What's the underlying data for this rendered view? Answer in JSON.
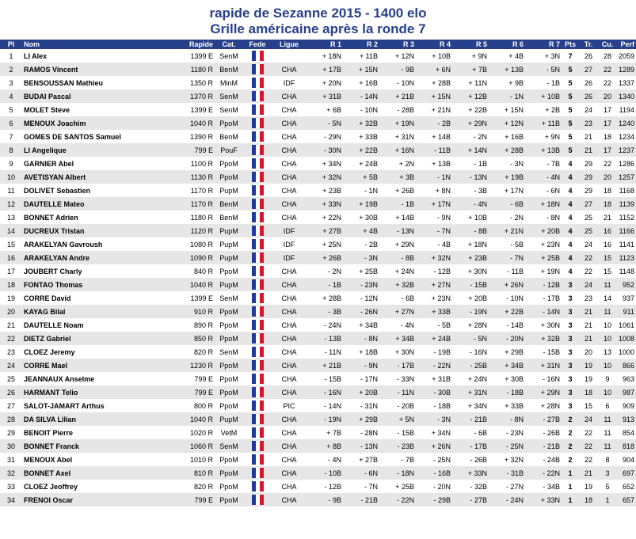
{
  "title": "rapide de Sezanne 2015 - 1400 elo",
  "subtitle": "Grille américaine après la ronde 7",
  "headers": [
    "Pl",
    "Nom",
    "Rapide",
    "Cat.",
    "Fede",
    "Ligue",
    "R 1",
    "R 2",
    "R 3",
    "R 4",
    "R 5",
    "R 6",
    "R 7",
    "Pts",
    "Tr.",
    "Cu.",
    "Perf"
  ],
  "flag": "FR flag",
  "rows": [
    [
      "1",
      "LI Alex",
      "1399 E",
      "SenM",
      "",
      "+ 18N",
      "+ 11B",
      "+ 12N",
      "+ 10B",
      "+ 9N",
      "+ 4B",
      "+ 3N",
      "7",
      "26",
      "28",
      "2059"
    ],
    [
      "2",
      "RAMOS Vincent",
      "1180 R",
      "BenM",
      "CHA",
      "+ 17B",
      "+ 15N",
      "- 9B",
      "+ 6N",
      "+ 7B",
      "+ 13B",
      "- 5N",
      "5",
      "27",
      "22",
      "1289"
    ],
    [
      "3",
      "BENSOUSSAN Mathieu",
      "1350 R",
      "MinM",
      "IDF",
      "+ 20N",
      "+ 16B",
      "- 10N",
      "+ 28B",
      "+ 11N",
      "+ 9B",
      "- 1B",
      "5",
      "26",
      "22",
      "1337"
    ],
    [
      "4",
      "BUDAI Pascal",
      "1370 R",
      "SenM",
      "CHA",
      "+ 31B",
      "- 14N",
      "+ 21B",
      "+ 15N",
      "+ 12B",
      "- 1N",
      "+ 10B",
      "5",
      "26",
      "20",
      "1340"
    ],
    [
      "5",
      "MOLET Steve",
      "1399 E",
      "SenM",
      "CHA",
      "+ 6B",
      "- 10N",
      "- 28B",
      "+ 21N",
      "+ 22B",
      "+ 15N",
      "+ 2B",
      "5",
      "24",
      "17",
      "1194"
    ],
    [
      "6",
      "MENOUX Joachim",
      "1040 R",
      "PpoM",
      "CHA",
      "- 5N",
      "+ 32B",
      "+ 19N",
      "- 2B",
      "+ 29N",
      "+ 12N",
      "+ 11B",
      "5",
      "23",
      "17",
      "1240"
    ],
    [
      "7",
      "GOMES DE SANTOS Samuel",
      "1390 R",
      "BenM",
      "CHA",
      "- 29N",
      "+ 33B",
      "+ 31N",
      "+ 14B",
      "- 2N",
      "+ 16B",
      "+ 9N",
      "5",
      "21",
      "18",
      "1234"
    ],
    [
      "8",
      "LI Angelique",
      "799 E",
      "PouF",
      "CHA",
      "- 30N",
      "+ 22B",
      "+ 16N",
      "- 11B",
      "+ 14N",
      "+ 28B",
      "+ 13B",
      "5",
      "21",
      "17",
      "1237"
    ],
    [
      "9",
      "GARNIER Abel",
      "1100 R",
      "PpoM",
      "CHA",
      "+ 34N",
      "+ 24B",
      "+ 2N",
      "+ 13B",
      "- 1B",
      "- 3N",
      "- 7B",
      "4",
      "29",
      "22",
      "1286"
    ],
    [
      "10",
      "AVETISYAN Albert",
      "1130 R",
      "PpoM",
      "CHA",
      "+ 32N",
      "+ 5B",
      "+ 3B",
      "- 1N",
      "- 13N",
      "+ 19B",
      "- 4N",
      "4",
      "29",
      "20",
      "1257"
    ],
    [
      "11",
      "DOLIVET Sebastien",
      "1170 R",
      "PupM",
      "CHA",
      "+ 23B",
      "- 1N",
      "+ 26B",
      "+ 8N",
      "- 3B",
      "+ 17N",
      "- 6N",
      "4",
      "29",
      "18",
      "1168"
    ],
    [
      "12",
      "DAUTELLE Mateo",
      "1170 R",
      "BenM",
      "CHA",
      "+ 33N",
      "+ 19B",
      "- 1B",
      "+ 17N",
      "- 4N",
      "- 6B",
      "+ 18N",
      "4",
      "27",
      "18",
      "1139"
    ],
    [
      "13",
      "BONNET Adrien",
      "1180 R",
      "BenM",
      "CHA",
      "+ 22N",
      "+ 30B",
      "+ 14B",
      "- 9N",
      "+ 10B",
      "- 2N",
      "- 8N",
      "4",
      "25",
      "21",
      "1152"
    ],
    [
      "14",
      "DUCREUX Tristan",
      "1120 R",
      "PupM",
      "IDF",
      "+ 27B",
      "+ 4B",
      "- 13N",
      "- 7N",
      "- 8B",
      "+ 21N",
      "+ 20B",
      "4",
      "25",
      "16",
      "1166"
    ],
    [
      "15",
      "ARAKELYAN Gavroush",
      "1080 R",
      "PupM",
      "IDF",
      "+ 25N",
      "- 2B",
      "+ 29N",
      "- 4B",
      "+ 18N",
      "- 5B",
      "+ 23N",
      "4",
      "24",
      "16",
      "1141"
    ],
    [
      "16",
      "ARAKELYAN Andre",
      "1090 R",
      "PupM",
      "IDF",
      "+ 26B",
      "- 3N",
      "- 8B",
      "+ 32N",
      "+ 23B",
      "- 7N",
      "+ 25B",
      "4",
      "22",
      "15",
      "1123"
    ],
    [
      "17",
      "JOUBERT Charly",
      "840 R",
      "PpoM",
      "CHA",
      "- 2N",
      "+ 25B",
      "+ 24N",
      "- 12B",
      "+ 30N",
      "- 11B",
      "+ 19N",
      "4",
      "22",
      "15",
      "1148"
    ],
    [
      "18",
      "FONTAO Thomas",
      "1040 R",
      "PupM",
      "CHA",
      "- 1B",
      "- 23N",
      "+ 32B",
      "+ 27N",
      "- 15B",
      "+ 26N",
      "- 12B",
      "3",
      "24",
      "11",
      "952"
    ],
    [
      "19",
      "CORRE David",
      "1399 E",
      "SenM",
      "CHA",
      "+ 28B",
      "- 12N",
      "- 6B",
      "+ 23N",
      "+ 20B",
      "- 10N",
      "- 17B",
      "3",
      "23",
      "14",
      "937"
    ],
    [
      "20",
      "KAYAG Bilal",
      "910 R",
      "PpoM",
      "CHA",
      "- 3B",
      "- 26N",
      "+ 27N",
      "+ 33B",
      "- 19N",
      "+ 22B",
      "- 14N",
      "3",
      "21",
      "11",
      "911"
    ],
    [
      "21",
      "DAUTELLE Noam",
      "890 R",
      "PpoM",
      "CHA",
      "- 24N",
      "+ 34B",
      "- 4N",
      "- 5B",
      "+ 28N",
      "- 14B",
      "+ 30N",
      "3",
      "21",
      "10",
      "1061"
    ],
    [
      "22",
      "DIETZ Gabriel",
      "850 R",
      "PpoM",
      "CHA",
      "- 13B",
      "- 8N",
      "+ 34B",
      "+ 24B",
      "- 5N",
      "- 20N",
      "+ 32B",
      "3",
      "21",
      "10",
      "1008"
    ],
    [
      "23",
      "CLOEZ Jeremy",
      "820 R",
      "SenM",
      "CHA",
      "- 11N",
      "+ 18B",
      "+ 30N",
      "- 19B",
      "- 16N",
      "+ 29B",
      "- 15B",
      "3",
      "20",
      "13",
      "1000"
    ],
    [
      "24",
      "CORRE Mael",
      "1230 R",
      "PpoM",
      "CHA",
      "+ 21B",
      "- 9N",
      "- 17B",
      "- 22N",
      "- 25B",
      "+ 34B",
      "+ 31N",
      "3",
      "19",
      "10",
      "866"
    ],
    [
      "25",
      "JEANNAUX Anselme",
      "799 E",
      "PpoM",
      "CHA",
      "- 15B",
      "- 17N",
      "- 33N",
      "+ 31B",
      "+ 24N",
      "+ 30B",
      "- 16N",
      "3",
      "19",
      "9",
      "963"
    ],
    [
      "26",
      "HARMANT Telio",
      "799 E",
      "PpoM",
      "CHA",
      "- 16N",
      "+ 20B",
      "- 11N",
      "- 30B",
      "+ 31N",
      "- 18B",
      "+ 29N",
      "3",
      "18",
      "10",
      "987"
    ],
    [
      "27",
      "SALOT-JAMART Arthus",
      "800 R",
      "PpoM",
      "PIC",
      "- 14N",
      "- 31N",
      "- 20B",
      "- 18B",
      "+ 34N",
      "+ 33B",
      "+ 28N",
      "3",
      "15",
      "6",
      "909"
    ],
    [
      "28",
      "DA SILVA Lilian",
      "1040 R",
      "PupM",
      "CHA",
      "- 19N",
      "+ 29B",
      "+ 5N",
      "- 3N",
      "- 21B",
      "- 8N",
      "- 27B",
      "2",
      "24",
      "11",
      "913"
    ],
    [
      "29",
      "BENOIT Pierre",
      "1020 R",
      "VetM",
      "CHA",
      "+ 7B",
      "- 28N",
      "- 15B",
      "+ 34N",
      "- 6B",
      "- 23N",
      "- 26B",
      "2",
      "22",
      "11",
      "854"
    ],
    [
      "30",
      "BONNET Franck",
      "1060 R",
      "SenM",
      "CHA",
      "+ 8B",
      "- 13N",
      "- 23B",
      "+ 26N",
      "- 17B",
      "- 25N",
      "- 21B",
      "2",
      "22",
      "11",
      "818"
    ],
    [
      "31",
      "MENOUX Abel",
      "1010 R",
      "PpoM",
      "CHA",
      "- 4N",
      "+ 27B",
      "- 7B",
      "- 25N",
      "- 26B",
      "+ 32N",
      "- 24B",
      "2",
      "22",
      "8",
      "904"
    ],
    [
      "32",
      "BONNET Axel",
      "810 R",
      "PpoM",
      "CHA",
      "- 10B",
      "- 6N",
      "- 18N",
      "- 16B",
      "+ 33N",
      "- 31B",
      "- 22N",
      "1",
      "21",
      "3",
      "697"
    ],
    [
      "33",
      "CLOEZ Jeoffrey",
      "820 R",
      "PpoM",
      "CHA",
      "- 12B",
      "- 7N",
      "+ 25B",
      "- 20N",
      "- 32B",
      "- 27N",
      "- 34B",
      "1",
      "19",
      "5",
      "652"
    ],
    [
      "34",
      "FRENOI Oscar",
      "799 E",
      "PpoM",
      "CHA",
      "- 9B",
      "- 21B",
      "- 22N",
      "- 29B",
      "- 27B",
      "- 24N",
      "+ 33N",
      "1",
      "18",
      "1",
      "657"
    ]
  ]
}
